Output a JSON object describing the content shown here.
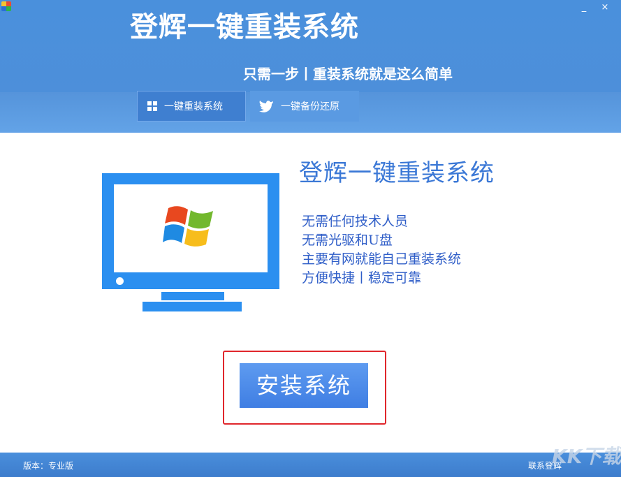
{
  "window": {
    "minimize_glyph": "_",
    "close_glyph": "×"
  },
  "header": {
    "title": "登辉一键重装系统",
    "slogan": "只需一步丨重装系统就是这么简单",
    "tabs": [
      {
        "label": "一键重装系统",
        "icon": "windows-icon"
      },
      {
        "label": "一键备份还原",
        "icon": "bird-icon"
      }
    ]
  },
  "main": {
    "title": "登辉一键重装系统",
    "features": [
      "无需任何技术人员",
      "无需光驱和U盘",
      "主要有网就能自己重装系统",
      "方便快捷丨稳定可靠"
    ],
    "install_label": "安装系统"
  },
  "footer": {
    "version": "版本：专业版",
    "contact": "联系登辉"
  },
  "watermark": "KK下载",
  "colors": {
    "header": "#4a90dc",
    "accent": "#2b8ff0",
    "highlight_border": "#e0262c"
  }
}
